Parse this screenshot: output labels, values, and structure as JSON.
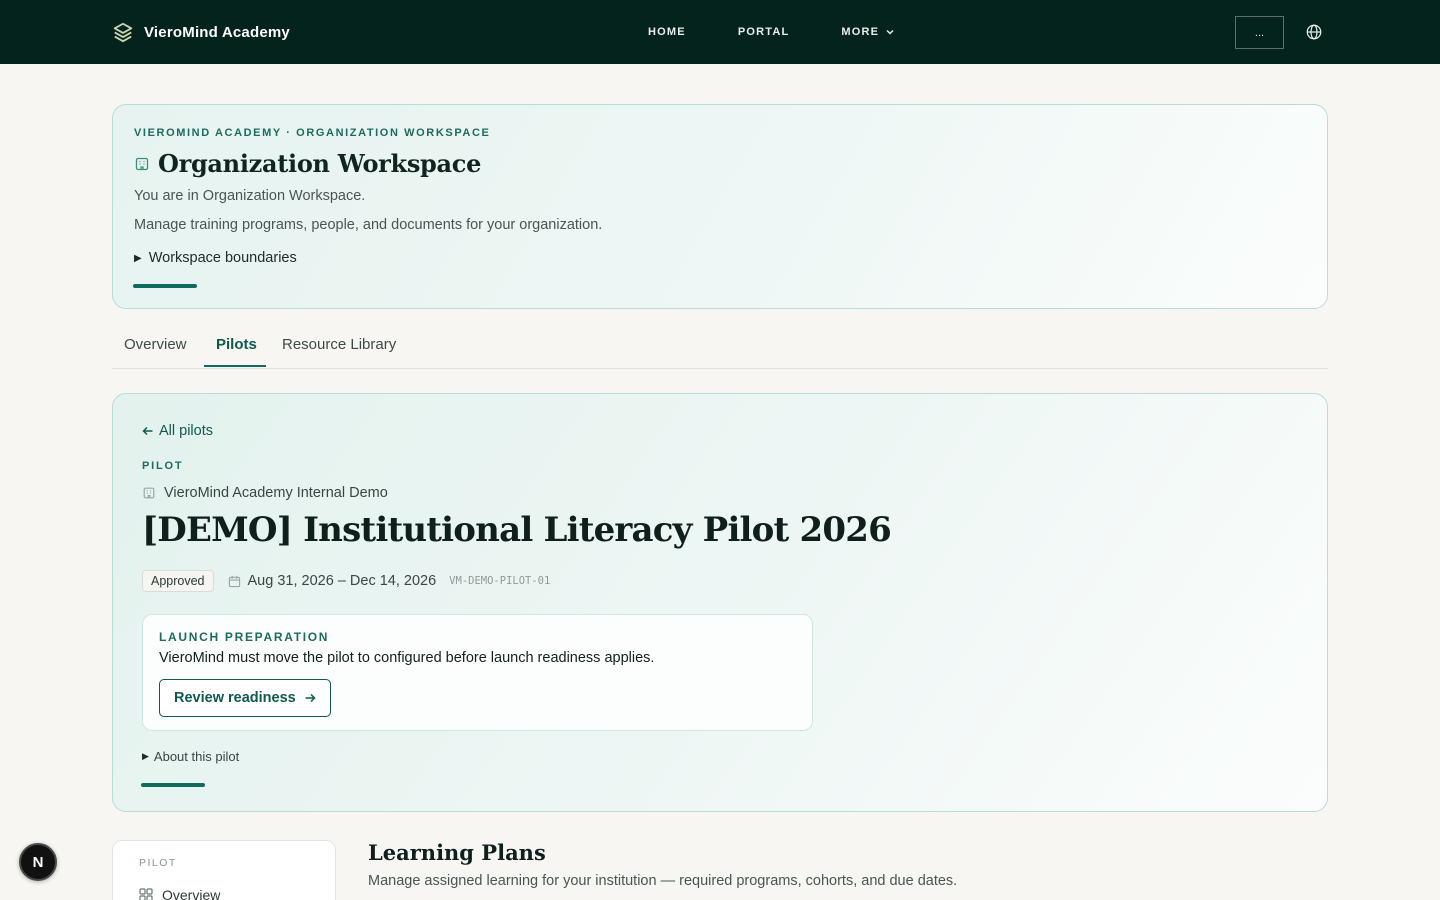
{
  "header": {
    "brand_name": "VieroMind Academy",
    "brand_icon": "layers-icon",
    "nav": [
      {
        "label": "HOME"
      },
      {
        "label": "PORTAL"
      },
      {
        "label": "MORE"
      }
    ],
    "lang_button_label": "...",
    "globe_icon": "globe-icon"
  },
  "workspace": {
    "eyebrow": "VIEROMIND ACADEMY · ORGANIZATION WORKSPACE",
    "title": "Organization Workspace",
    "line1": "You are in Organization Workspace.",
    "line2": "Manage training programs, people, and documents for your organization.",
    "details_label": "Workspace boundaries"
  },
  "tabs": [
    {
      "label": "Overview",
      "active": false
    },
    {
      "label": "Pilots",
      "active": true
    },
    {
      "label": "Resource Library",
      "active": false
    }
  ],
  "pilot": {
    "back_label": "All pilots",
    "eyebrow": "PILOT",
    "organization": "VieroMind Academy Internal Demo",
    "title": "[DEMO] Institutional Literacy Pilot 2026",
    "status": "Approved",
    "date_range": "Aug 31, 2026 – Dec 14, 2026",
    "code": "VM-DEMO-PILOT-01",
    "launch": {
      "eyebrow": "LAUNCH PREPARATION",
      "text": "VieroMind must move the pilot to configured before launch readiness applies.",
      "button_label": "Review readiness"
    },
    "about_label": "About this pilot"
  },
  "sidebar": {
    "eyebrow": "PILOT",
    "items": [
      {
        "label": "Overview",
        "icon": "grid-icon"
      }
    ]
  },
  "main": {
    "section_title": "Learning Plans",
    "section_subtitle": "Manage assigned learning for your institution — required programs, cohorts, and due dates."
  },
  "dev_badge": {
    "label": "N"
  },
  "colors": {
    "nav_bg": "#05231d",
    "accent": "#0f6b5c",
    "card_border": "#b7ddd5",
    "page_bg": "#f7f6f2"
  }
}
